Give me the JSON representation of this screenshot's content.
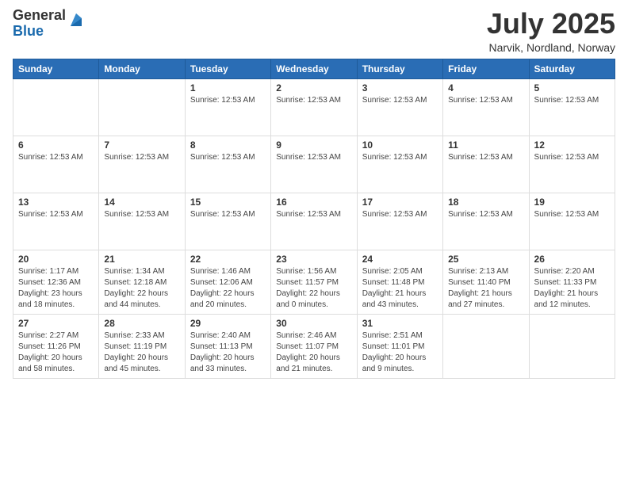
{
  "logo": {
    "general": "General",
    "blue": "Blue"
  },
  "header": {
    "month_year": "July 2025",
    "location": "Narvik, Nordland, Norway"
  },
  "weekdays": [
    "Sunday",
    "Monday",
    "Tuesday",
    "Wednesday",
    "Thursday",
    "Friday",
    "Saturday"
  ],
  "weeks": [
    [
      {
        "day": "",
        "info": ""
      },
      {
        "day": "",
        "info": ""
      },
      {
        "day": "1",
        "info": "Sunrise: 12:53 AM"
      },
      {
        "day": "2",
        "info": "Sunrise: 12:53 AM"
      },
      {
        "day": "3",
        "info": "Sunrise: 12:53 AM"
      },
      {
        "day": "4",
        "info": "Sunrise: 12:53 AM"
      },
      {
        "day": "5",
        "info": "Sunrise: 12:53 AM"
      }
    ],
    [
      {
        "day": "6",
        "info": "Sunrise: 12:53 AM"
      },
      {
        "day": "7",
        "info": "Sunrise: 12:53 AM"
      },
      {
        "day": "8",
        "info": "Sunrise: 12:53 AM"
      },
      {
        "day": "9",
        "info": "Sunrise: 12:53 AM"
      },
      {
        "day": "10",
        "info": "Sunrise: 12:53 AM"
      },
      {
        "day": "11",
        "info": "Sunrise: 12:53 AM"
      },
      {
        "day": "12",
        "info": "Sunrise: 12:53 AM"
      }
    ],
    [
      {
        "day": "13",
        "info": "Sunrise: 12:53 AM"
      },
      {
        "day": "14",
        "info": "Sunrise: 12:53 AM"
      },
      {
        "day": "15",
        "info": "Sunrise: 12:53 AM"
      },
      {
        "day": "16",
        "info": "Sunrise: 12:53 AM"
      },
      {
        "day": "17",
        "info": "Sunrise: 12:53 AM"
      },
      {
        "day": "18",
        "info": "Sunrise: 12:53 AM"
      },
      {
        "day": "19",
        "info": "Sunrise: 12:53 AM"
      }
    ],
    [
      {
        "day": "20",
        "info": "Sunrise: 1:17 AM\nSunset: 12:36 AM\nDaylight: 23 hours and 18 minutes."
      },
      {
        "day": "21",
        "info": "Sunrise: 1:34 AM\nSunset: 12:18 AM\nDaylight: 22 hours and 44 minutes."
      },
      {
        "day": "22",
        "info": "Sunrise: 1:46 AM\nSunset: 12:06 AM\nDaylight: 22 hours and 20 minutes."
      },
      {
        "day": "23",
        "info": "Sunrise: 1:56 AM\nSunset: 11:57 PM\nDaylight: 22 hours and 0 minutes."
      },
      {
        "day": "24",
        "info": "Sunrise: 2:05 AM\nSunset: 11:48 PM\nDaylight: 21 hours and 43 minutes."
      },
      {
        "day": "25",
        "info": "Sunrise: 2:13 AM\nSunset: 11:40 PM\nDaylight: 21 hours and 27 minutes."
      },
      {
        "day": "26",
        "info": "Sunrise: 2:20 AM\nSunset: 11:33 PM\nDaylight: 21 hours and 12 minutes."
      }
    ],
    [
      {
        "day": "27",
        "info": "Sunrise: 2:27 AM\nSunset: 11:26 PM\nDaylight: 20 hours and 58 minutes."
      },
      {
        "day": "28",
        "info": "Sunrise: 2:33 AM\nSunset: 11:19 PM\nDaylight: 20 hours and 45 minutes."
      },
      {
        "day": "29",
        "info": "Sunrise: 2:40 AM\nSunset: 11:13 PM\nDaylight: 20 hours and 33 minutes."
      },
      {
        "day": "30",
        "info": "Sunrise: 2:46 AM\nSunset: 11:07 PM\nDaylight: 20 hours and 21 minutes."
      },
      {
        "day": "31",
        "info": "Sunrise: 2:51 AM\nSunset: 11:01 PM\nDaylight: 20 hours and 9 minutes."
      },
      {
        "day": "",
        "info": ""
      },
      {
        "day": "",
        "info": ""
      }
    ]
  ]
}
